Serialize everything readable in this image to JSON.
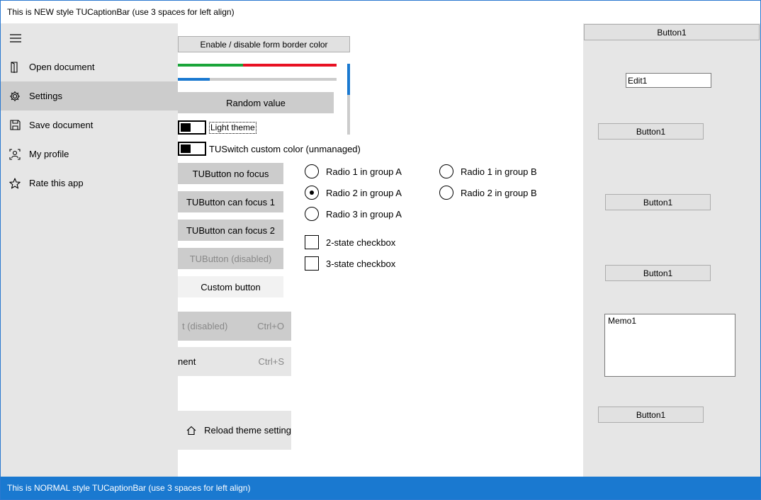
{
  "caption": {
    "title": "This is NEW style TUCaptionBar (use 3 spaces for left align)"
  },
  "statusbar": {
    "text": "This is NORMAL style TUCaptionBar (use 3 spaces for left align)"
  },
  "drawer": {
    "items": [
      {
        "label": "Open document",
        "icon": "open-document-icon",
        "active": false
      },
      {
        "label": "Settings",
        "icon": "gear-icon",
        "active": true
      },
      {
        "label": "Save document",
        "icon": "save-icon",
        "active": false
      },
      {
        "label": "My profile",
        "icon": "profile-icon",
        "active": false
      },
      {
        "label": "Rate this app",
        "icon": "star-icon",
        "active": false
      }
    ]
  },
  "main": {
    "border_color_button": "Enable / disable form border color",
    "random_button": "Random value",
    "light_theme_switch": "Light theme",
    "custom_switch": "TUSwitch custom color (unmanaged)",
    "buttons": {
      "no_focus": "TUButton no focus",
      "can_focus_1": "TUButton can focus 1",
      "can_focus_2": "TUButton can focus 2",
      "disabled": "TUButton (disabled)",
      "custom": "Custom button"
    },
    "menu_items": [
      {
        "label": "t (disabled)",
        "shortcut": "Ctrl+O"
      },
      {
        "label": "nent",
        "shortcut": "Ctrl+S"
      }
    ],
    "reload_button": "Reload theme setting",
    "radios_a": [
      {
        "label": "Radio 1 in group A",
        "checked": false
      },
      {
        "label": "Radio 2 in group A",
        "checked": true
      },
      {
        "label": "Radio 3 in group A",
        "checked": false
      }
    ],
    "radios_b": [
      {
        "label": "Radio 1 in group B",
        "checked": false
      },
      {
        "label": "Radio 2 in group B",
        "checked": false
      }
    ],
    "checkboxes": [
      {
        "label": "2-state checkbox",
        "checked": false
      },
      {
        "label": "3-state checkbox",
        "checked": false
      }
    ],
    "progress": {
      "green_fraction": 0.41,
      "red_fraction": 0.59,
      "blue_fraction": 0.2
    },
    "colors": {
      "accent": "#1a79d0",
      "green": "#1aa53a",
      "red": "#e81123"
    }
  },
  "right": {
    "top_button": "Button1",
    "edit": "Edit1",
    "button_a": "Button1",
    "button_b": "Button1",
    "button_c": "Button1",
    "memo": "Memo1",
    "button_d": "Button1"
  }
}
